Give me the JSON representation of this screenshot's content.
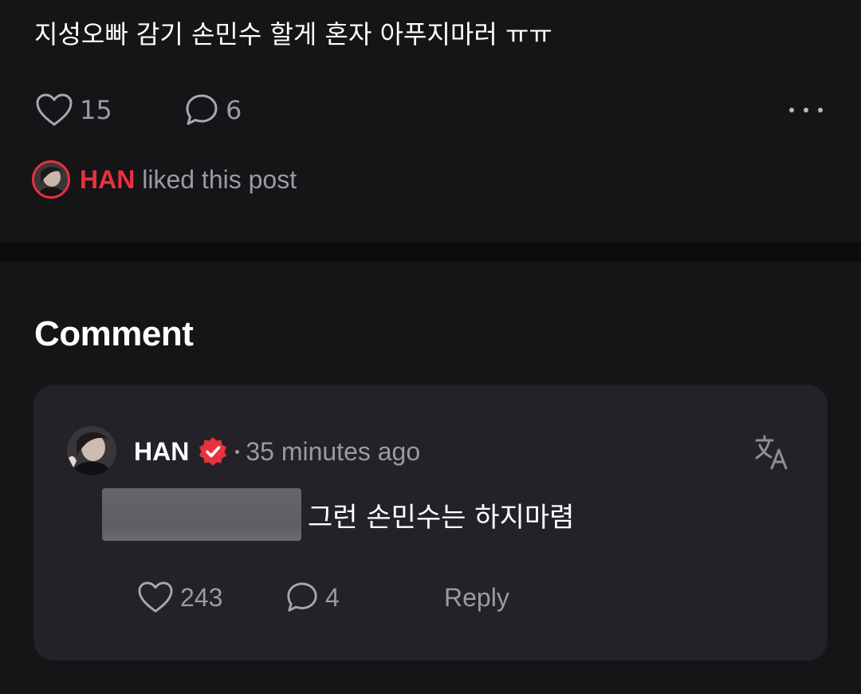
{
  "post": {
    "text": "지성오빠 감기 손민수 할게 혼자 아푸지마러 ㅠㅠ",
    "like_count": "15",
    "comment_count": "6",
    "liked_by_name": "HAN",
    "liked_by_suffix": " liked this post"
  },
  "comments_section": {
    "title": "Comment",
    "comment": {
      "author": "HAN",
      "time": "35 minutes ago",
      "text": "그런 손민수는 하지마렴",
      "like_count": "243",
      "reply_count": "4",
      "reply_label": "Reply"
    }
  },
  "icons": {
    "like": "heart-outline-icon",
    "comment": "speech-bubble-icon",
    "more": "more-horizontal-icon",
    "verified": "verified-badge-icon",
    "translate": "translate-icon"
  },
  "colors": {
    "background": "#151417",
    "card": "#232228",
    "accent_red": "#e8323e",
    "muted_text": "#9b9aa2"
  }
}
